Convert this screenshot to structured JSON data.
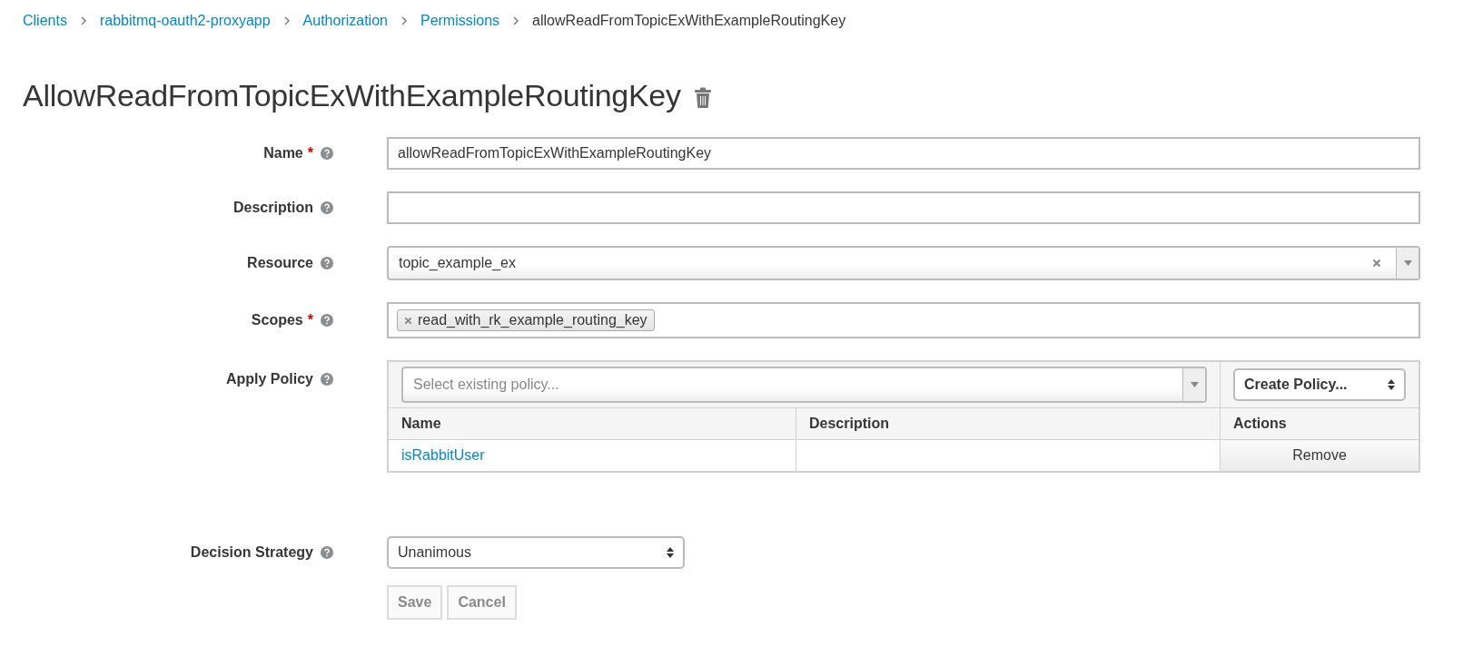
{
  "breadcrumb": [
    {
      "label": "Clients",
      "link": true
    },
    {
      "label": "rabbitmq-oauth2-proxyapp",
      "link": true
    },
    {
      "label": "Authorization",
      "link": true
    },
    {
      "label": "Permissions",
      "link": true
    },
    {
      "label": "allowReadFromTopicExWithExampleRoutingKey",
      "link": false
    }
  ],
  "title": "AllowReadFromTopicExWithExampleRoutingKey",
  "fields": [
    {
      "kind": "text",
      "label": "Name",
      "required_mark": "*",
      "value": "allowReadFromTopicExWithExampleRoutingKey"
    },
    {
      "kind": "text",
      "label": "Description"
    },
    {
      "kind": "select",
      "label": "Resource",
      "value": "topic_example_ex"
    },
    {
      "kind": "tags",
      "label": "Scopes",
      "required_mark": "*",
      "tags": [
        "read_with_rk_example_routing_key"
      ]
    },
    {
      "kind": "policy",
      "label": "Apply Policy",
      "placeholder": "Select existing policy...",
      "create": "Create Policy...",
      "columns": [
        "Name",
        "Description",
        "Actions"
      ],
      "rows": [
        {
          "name": "isRabbitUser",
          "action": "Remove"
        }
      ]
    }
  ],
  "decision": {
    "label": "Decision Strategy",
    "value": "Unanimous"
  },
  "buttons": [
    {
      "label": "Save",
      "disabled": true
    },
    {
      "label": "Cancel",
      "disabled": true
    }
  ]
}
